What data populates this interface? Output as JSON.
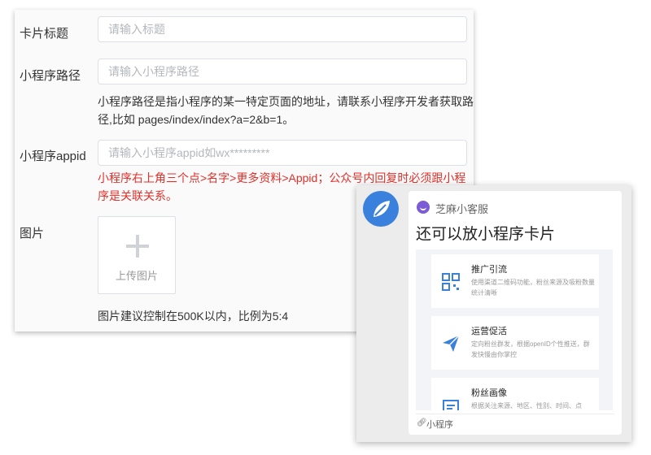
{
  "form": {
    "fields": [
      {
        "label": "卡片标题",
        "placeholder": "请输入标题"
      },
      {
        "label": "小程序路径",
        "placeholder": "请输入小程序路径",
        "help": "小程序路径是指小程序的某一特定页面的地址，请联系小程序开发者获取路径,比如 pages/index/index?a=2&b=1。"
      },
      {
        "label": "小程序appid",
        "placeholder": "请输入小程序appid如wx*********",
        "help": "小程序右上角三个点>名字>更多资料>Appid；公众号内回复时必须跟小程序是关联关系。"
      }
    ],
    "image": {
      "label": "图片",
      "upload_label": "上传图片",
      "help": "图片建议控制在500K以内，比例为5:4"
    }
  },
  "preview": {
    "brand_name": "芝麻小客服",
    "title": "还可以放小程序卡片",
    "features": [
      {
        "title": "推广引流",
        "desc": "使用渠道二维码功能，粉丝来源及吸粉数量统计清晰",
        "icon": "qr-code-icon"
      },
      {
        "title": "运营促活",
        "desc": "定向粉丝群发，根据openID个性推送，群发快慢由你掌控",
        "icon": "paper-plane-icon"
      },
      {
        "title": "粉丝画像",
        "desc": "根据关注来源、地区、性别、时间、点",
        "icon": "profile-card-icon"
      }
    ],
    "footer_label": "小程序",
    "accent_color": "#3a80dd",
    "error_color": "#e0302a"
  }
}
